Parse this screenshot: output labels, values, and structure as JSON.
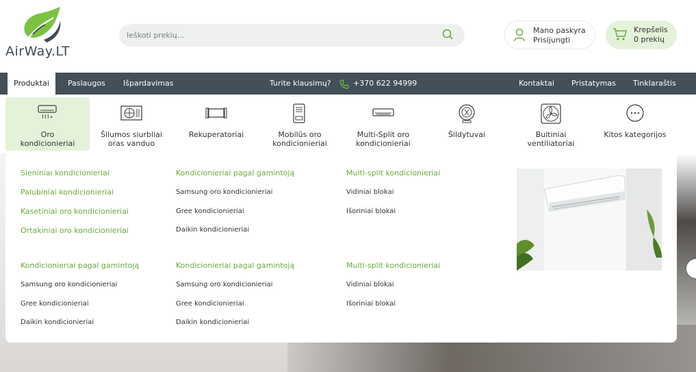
{
  "brand": {
    "name": "AirWay.LT",
    "accent": "#6aab3c",
    "dark": "#434f59"
  },
  "search": {
    "placeholder": "Ieškoti prekių...",
    "icon": "search-icon"
  },
  "account": {
    "title": "Mano paskyra",
    "subtitle": "Prisijungti",
    "icon": "user-icon"
  },
  "cart": {
    "title": "Krepšelis",
    "subtitle": "0 prekių",
    "icon": "cart-icon"
  },
  "nav": {
    "left": [
      "Produktai",
      "Paslaugos",
      "Išpardavimas"
    ],
    "question": "Turite klausimų?",
    "phone": "+370 622 94999",
    "right": [
      "Kontaktai",
      "Pristatymas",
      "Tinklaraštis"
    ]
  },
  "categories": [
    {
      "line1": "Oro",
      "line2": "kondicionieriai",
      "icon": "air-conditioner-icon"
    },
    {
      "line1": "Šilumos siurbliai",
      "line2": "oras vanduo",
      "icon": "heat-pump-icon"
    },
    {
      "line1": "Rekuperatoriai",
      "line2": "",
      "icon": "recuperator-icon"
    },
    {
      "line1": "Mobilūs oro",
      "line2": "kondicionieriai",
      "icon": "mobile-ac-icon"
    },
    {
      "line1": "Multi-Split oro",
      "line2": "kondicionieriai",
      "icon": "multi-split-icon"
    },
    {
      "line1": "Šildytuvai",
      "line2": "",
      "icon": "heater-icon"
    },
    {
      "line1": "Buitiniai",
      "line2": "ventiliatoriai",
      "icon": "fan-icon"
    },
    {
      "line1": "Kitos kategorijos",
      "line2": "",
      "icon": "more-icon"
    }
  ],
  "menu": {
    "col1_top": [
      "Sieniniai kondicionieriai",
      "Palubiniai kondicionieriai",
      "Kasetiniai oro kondicionieriai",
      "Ortakiniai oro kondicionieriai"
    ],
    "col2_top": {
      "heading": "Kondicionieriai pagal gamintoją",
      "items": [
        "Samsung oro kondicionieriai",
        "Gree kondicionieriai",
        "Daikin kondicionieriai"
      ]
    },
    "col3_top": {
      "heading": "Multi-split kondicionieriai",
      "items": [
        "Vidiniai blokai",
        "Išoriniai blokai"
      ]
    },
    "col1_bottom": {
      "heading": "Kondicionieriai pagal gamintoją",
      "items": [
        "Samsung oro kondicionieriai",
        "Gree kondicionieriai",
        "Daikin kondicionieriai"
      ]
    },
    "col2_bottom": {
      "heading": "Kondicionieriai pagal gamintoją",
      "items": [
        "Samsung oro kondicionieriai",
        "Gree kondicionieriai",
        "Daikin kondicionieriai"
      ]
    },
    "col3_bottom": {
      "heading": "Multi-split kondicionieriai",
      "items": [
        "Vidiniai blokai",
        "Išoriniai blokai"
      ]
    }
  }
}
